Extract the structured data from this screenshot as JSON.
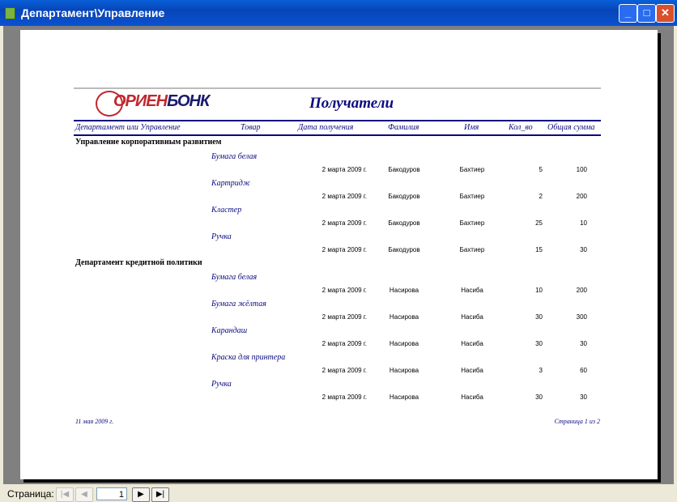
{
  "window": {
    "title": "Департамент\\Управление"
  },
  "report": {
    "logo": {
      "a": "ОРИЕН",
      "b": "БОНК"
    },
    "title": "Получатели",
    "columns": [
      "Департамент или Управление",
      "Товар",
      "Дата получения",
      "Фамилия",
      "Имя",
      "Кол_во",
      "Общая сумма"
    ],
    "groups": [
      {
        "name": "Управление корпоративным развитием",
        "items": [
          {
            "product": "Бумага белая",
            "date": "2 марта 2009 г.",
            "last": "Бакодуров",
            "first": "Бахтиер",
            "qty": "5",
            "sum": "100"
          },
          {
            "product": "Картридж",
            "date": "2 марта 2009 г.",
            "last": "Бакодуров",
            "first": "Бахтиер",
            "qty": "2",
            "sum": "200"
          },
          {
            "product": "Кластер",
            "date": "2 марта 2009 г.",
            "last": "Бакодуров",
            "first": "Бахтиер",
            "qty": "25",
            "sum": "10"
          },
          {
            "product": "Ручка",
            "date": "2 марта 2009 г.",
            "last": "Бакодуров",
            "first": "Бахтиер",
            "qty": "15",
            "sum": "30"
          }
        ]
      },
      {
        "name": "Департамент кредитной политики",
        "items": [
          {
            "product": "Бумага белая",
            "date": "2 марта 2009 г.",
            "last": "Насирова",
            "first": "Насиба",
            "qty": "10",
            "sum": "200"
          },
          {
            "product": "Бумага жёлтая",
            "date": "2 марта 2009 г.",
            "last": "Насирова",
            "first": "Насиба",
            "qty": "30",
            "sum": "300"
          },
          {
            "product": "Карандаш",
            "date": "2 марта 2009 г.",
            "last": "Насирова",
            "first": "Насиба",
            "qty": "30",
            "sum": "30"
          },
          {
            "product": "Краска для принтера",
            "date": "2 марта 2009 г.",
            "last": "Насирова",
            "first": "Насиба",
            "qty": "3",
            "sum": "60"
          },
          {
            "product": "Ручка",
            "date": "2 марта 2009 г.",
            "last": "Насирова",
            "first": "Насиба",
            "qty": "30",
            "sum": "30"
          }
        ]
      }
    ],
    "footer_date": "11 мая 2009 г.",
    "footer_page": "Страница 1 из 2"
  },
  "nav": {
    "label": "Страница:",
    "page": "1"
  }
}
